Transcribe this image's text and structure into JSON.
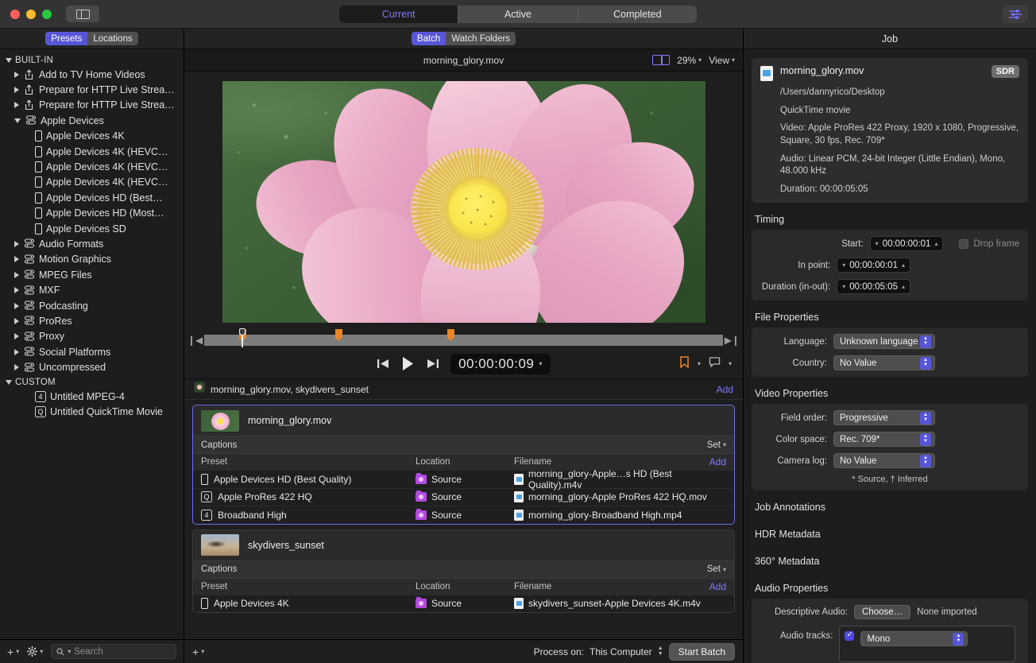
{
  "titlebar": {
    "sidebar_toggle": "sidebar-toggle",
    "segments": [
      {
        "label": "Current",
        "active": true
      },
      {
        "label": "Active",
        "active": false
      },
      {
        "label": "Completed",
        "active": false
      }
    ],
    "inspector_button": "inspector-toggle"
  },
  "sidebar": {
    "tabs": [
      {
        "label": "Presets",
        "active": true
      },
      {
        "label": "Locations",
        "active": false
      }
    ],
    "groups": [
      {
        "label": "BUILT-IN",
        "expanded": true,
        "items": [
          {
            "label": "Add to TV Home Videos",
            "icon": "share-icon",
            "expandable": true,
            "expanded": false
          },
          {
            "label": "Prepare for HTTP Live Strea…",
            "icon": "share-icon",
            "expandable": true,
            "expanded": false
          },
          {
            "label": "Prepare for HTTP Live Strea…",
            "icon": "share-icon",
            "expandable": true,
            "expanded": false
          },
          {
            "label": "Apple Devices",
            "icon": "preset-group-icon",
            "expandable": true,
            "expanded": true,
            "children": [
              {
                "label": "Apple Devices 4K",
                "icon": "device-icon"
              },
              {
                "label": "Apple Devices 4K (HEVC…",
                "icon": "device-icon"
              },
              {
                "label": "Apple Devices 4K (HEVC…",
                "icon": "device-icon"
              },
              {
                "label": "Apple Devices 4K (HEVC…",
                "icon": "device-icon"
              },
              {
                "label": "Apple Devices HD (Best…",
                "icon": "device-icon"
              },
              {
                "label": "Apple Devices HD (Most…",
                "icon": "device-icon"
              },
              {
                "label": "Apple Devices SD",
                "icon": "device-icon"
              }
            ]
          },
          {
            "label": "Audio Formats",
            "icon": "preset-group-icon",
            "expandable": true,
            "expanded": false
          },
          {
            "label": "Motion Graphics",
            "icon": "preset-group-icon",
            "expandable": true,
            "expanded": false
          },
          {
            "label": "MPEG Files",
            "icon": "preset-group-icon",
            "expandable": true,
            "expanded": false
          },
          {
            "label": "MXF",
            "icon": "preset-group-icon",
            "expandable": true,
            "expanded": false
          },
          {
            "label": "Podcasting",
            "icon": "preset-group-icon",
            "expandable": true,
            "expanded": false
          },
          {
            "label": "ProRes",
            "icon": "preset-group-icon",
            "expandable": true,
            "expanded": false
          },
          {
            "label": "Proxy",
            "icon": "preset-group-icon",
            "expandable": true,
            "expanded": false
          },
          {
            "label": "Social Platforms",
            "icon": "preset-group-icon",
            "expandable": true,
            "expanded": false
          },
          {
            "label": "Uncompressed",
            "icon": "preset-group-icon",
            "expandable": true,
            "expanded": false
          }
        ]
      },
      {
        "label": "CUSTOM",
        "expanded": true,
        "items": [
          {
            "label": "Untitled MPEG-4",
            "icon": "mpeg4-icon",
            "badge": "4",
            "expandable": false
          },
          {
            "label": "Untitled QuickTime Movie",
            "icon": "quicktime-icon",
            "badge": "Q",
            "expandable": false
          }
        ]
      }
    ],
    "footer": {
      "add_label": "+",
      "settings_label": "gear",
      "search_placeholder": "Search"
    }
  },
  "center": {
    "tabs": [
      {
        "label": "Batch",
        "active": true
      },
      {
        "label": "Watch Folders",
        "active": false
      }
    ],
    "preview": {
      "filename": "morning_glory.mov",
      "zoom": "29%",
      "view_label": "View",
      "split_icon": "split-view-icon"
    },
    "transport": {
      "prev_icon": "skip-to-start-icon",
      "play_icon": "play-icon",
      "next_icon": "skip-to-end-icon",
      "timecode": "00:00:00:09",
      "marker_icon": "bookmark-icon",
      "caption_icon": "caption-bubble-icon"
    },
    "batch": {
      "title": "morning_glory.mov, skydivers_sunset",
      "add_label": "Add",
      "jobs": [
        {
          "name": "morning_glory.mov",
          "thumb": "flower",
          "selected": true,
          "captions_label": "Captions",
          "captions_set": "Set",
          "columns": [
            "Preset",
            "Location",
            "Filename"
          ],
          "add_label": "Add",
          "rows": [
            {
              "preset": "Apple Devices HD (Best Quality)",
              "preset_icon": "device-icon",
              "location": "Source",
              "filename": "morning_glory-Apple…s HD (Best Quality).m4v",
              "file_icon": "m4v-file-icon"
            },
            {
              "preset": "Apple ProRes 422 HQ",
              "preset_icon": "quicktime-icon",
              "location": "Source",
              "filename": "morning_glory-Apple ProRes 422 HQ.mov",
              "file_icon": "mov-file-icon"
            },
            {
              "preset": "Broadband High",
              "preset_icon": "mpeg4-icon",
              "location": "Source",
              "filename": "morning_glory-Broadband High.mp4",
              "file_icon": "mp4-file-icon"
            }
          ]
        },
        {
          "name": "skydivers_sunset",
          "thumb": "sky",
          "selected": false,
          "captions_label": "Captions",
          "captions_set": "Set",
          "columns": [
            "Preset",
            "Location",
            "Filename"
          ],
          "add_label": "Add",
          "rows": [
            {
              "preset": "Apple Devices 4K",
              "preset_icon": "device-icon",
              "location": "Source",
              "filename": "skydivers_sunset-Apple Devices 4K.m4v",
              "file_icon": "m4v-file-icon"
            }
          ]
        }
      ]
    },
    "footer": {
      "add_label": "+",
      "process_label": "Process on:",
      "process_value": "This Computer",
      "start_label": "Start Batch"
    }
  },
  "inspector": {
    "title": "Job",
    "file": {
      "name": "morning_glory.mov",
      "badge": "SDR",
      "path": "/Users/dannyrico/Desktop",
      "kind": "QuickTime movie",
      "video": "Video: Apple ProRes 422 Proxy, 1920 x 1080, Progressive, Square, 30 fps, Rec. 709*",
      "audio": "Audio: Linear PCM, 24-bit Integer (Little Endian), Mono, 48.000 kHz",
      "duration": "Duration: 00:00:05:05"
    },
    "sections": {
      "timing": {
        "title": "Timing",
        "start_label": "Start:",
        "start_value": "00:00:00:01",
        "in_label": "In point:",
        "in_value": "00:00:00:01",
        "duration_label": "Duration (in-out):",
        "duration_value": "00:00:05:05",
        "drop_frame_label": "Drop frame",
        "drop_frame_checked": false
      },
      "file_properties": {
        "title": "File Properties",
        "language_label": "Language:",
        "language_value": "Unknown language",
        "country_label": "Country:",
        "country_value": "No Value"
      },
      "video_properties": {
        "title": "Video Properties",
        "field_order_label": "Field order:",
        "field_order_value": "Progressive",
        "color_space_label": "Color space:",
        "color_space_value": "Rec. 709*",
        "camera_log_label": "Camera log:",
        "camera_log_value": "No Value",
        "legend": "* Source, † Inferred"
      },
      "job_annotations": {
        "title": "Job Annotations"
      },
      "hdr_metadata": {
        "title": "HDR Metadata"
      },
      "metadata_360": {
        "title": "360° Metadata"
      },
      "audio_properties": {
        "title": "Audio Properties",
        "descriptive_label": "Descriptive Audio:",
        "choose_label": "Choose…",
        "none_imported": "None imported",
        "tracks_label": "Audio tracks:",
        "track_value": "Mono",
        "track_checked": true
      }
    }
  },
  "colors": {
    "accent": "#5856d6",
    "link": "#7d7aff",
    "marker": "#e8862a",
    "folder": "#b44ae0",
    "window_bg": "#1e1e1e"
  }
}
